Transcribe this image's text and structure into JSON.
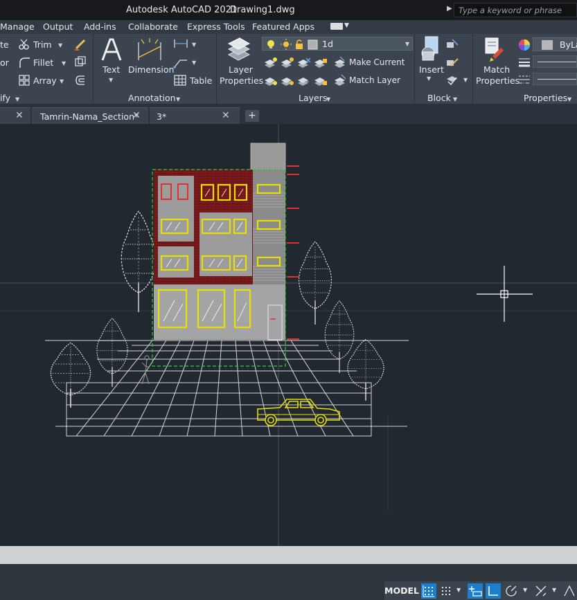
{
  "titlebar": {
    "app_title": "Autodesk AutoCAD 2021",
    "document_title": "Drawing1.dwg",
    "search_placeholder": "Type a keyword or phrase"
  },
  "menu": {
    "items": [
      "Manage",
      "Output",
      "Add-ins",
      "Collaborate",
      "Express Tools",
      "Featured Apps"
    ]
  },
  "ribbon": {
    "modify": {
      "partial_top": "te",
      "partial_mid": "or",
      "trim": "Trim",
      "fillet": "Fillet",
      "array": "Array",
      "panel_title": "ify"
    },
    "annotation": {
      "text": "Text",
      "dimension": "Dimension",
      "table": "Table",
      "panel_title": "Annotation"
    },
    "layers": {
      "layer_properties_1": "Layer",
      "layer_properties_2": "Properties",
      "current_layer": "1d",
      "make_current": "Make Current",
      "match_layer": "Match Layer",
      "panel_title": "Layers"
    },
    "block": {
      "insert": "Insert",
      "panel_title": "Block"
    },
    "properties": {
      "match_1": "Match",
      "match_2": "Properties",
      "bylayer": "ByLa",
      "panel_title": "Properties"
    }
  },
  "tabs": [
    {
      "label": "Tamrin-Nama_Section*"
    },
    {
      "label": "3*"
    }
  ],
  "status": {
    "model": "MODEL"
  },
  "colors": {
    "accent": "#1b7fd0",
    "drawing_bg": "#212830",
    "brick": "#6b1418",
    "window_yellow": "#e8e000"
  }
}
